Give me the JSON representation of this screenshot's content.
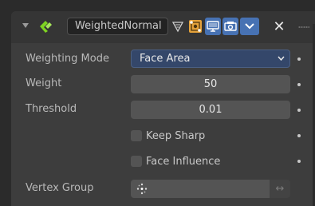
{
  "header": {
    "modifier_name": "WeightedNormal",
    "icons": {
      "collapse": "disclosure-triangle-icon",
      "modifier_type": "weighted-normal-modifier-icon",
      "show_on_cage": "on-cage-triangle-icon",
      "show_in_editmode": "edit-mode-icon",
      "show_viewport": "viewport-display-icon",
      "show_render": "render-camera-icon",
      "dropdown": "chevron-down-icon",
      "delete": "close-icon",
      "drag": "drag-handle-icon"
    },
    "delete_label": "✕"
  },
  "properties": {
    "weighting_mode": {
      "label": "Weighting Mode",
      "value": "Face Area"
    },
    "weight": {
      "label": "Weight",
      "value": "50"
    },
    "threshold": {
      "label": "Threshold",
      "value": "0.01"
    },
    "keep_sharp": {
      "label": "Keep Sharp",
      "checked": false
    },
    "face_influence": {
      "label": "Face Influence",
      "checked": false
    },
    "vertex_group": {
      "label": "Vertex Group",
      "value": "",
      "invert_label": "↔"
    }
  },
  "colors": {
    "panel_bg": "#3d3d3d",
    "header_bg": "#353535",
    "dropdown_bg": "#34476a",
    "field_bg": "#545454",
    "active_toggle": "#4772b3",
    "modifier_icon": "#7ed321"
  }
}
